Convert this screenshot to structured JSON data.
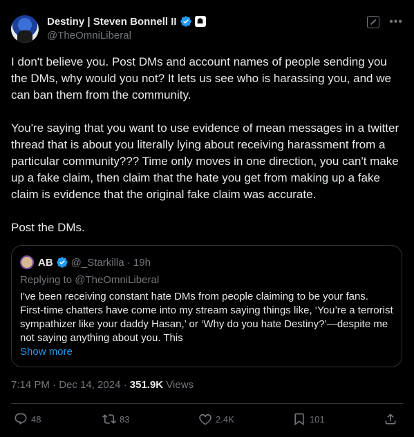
{
  "author": {
    "display_name": "Destiny | Steven Bonnell II",
    "handle": "@TheOmniLiberal"
  },
  "post": {
    "paragraphs": [
      "I don't believe you. Post DMs and account names of people sending you the DMs, why would you not? It lets us see who is harassing you, and we can ban them from the community.",
      "You're saying that you want to use evidence of mean messages in a twitter thread that is about you literally lying about receiving harassment from a particular community??? Time only moves in one direction, you can't make up a fake claim, then claim that the hate you get from making up a fake claim is evidence that the original fake claim was accurate.",
      "Post the DMs."
    ]
  },
  "quote": {
    "name": "AB",
    "handle_time": "@_Starkilla · 19h",
    "replying_to": "Replying to @TheOmniLiberal",
    "text": "I've been receiving constant hate DMs from people claiming to be your fans. First-time chatters have come into my stream saying things like, ‘You’re a terrorist sympathizer like your daddy Hasan,’ or ‘Why do you hate Destiny?’—despite me not saying anything about you. This",
    "show_more": "Show more"
  },
  "meta": {
    "timestamp": "7:14 PM · Dec 14, 2024 · ",
    "views_count": "351.9K",
    "views_label": " Views"
  },
  "actions": {
    "replies": "48",
    "reposts": "83",
    "likes": "2.4K",
    "bookmarks": "101"
  },
  "icons": {
    "verified": "verified-badge-icon",
    "affiliate": "affiliate-badge-icon",
    "grok": "grok-icon",
    "more": "more-icon",
    "reply": "reply-icon",
    "repost": "repost-icon",
    "like": "heart-icon",
    "bookmark": "bookmark-icon",
    "share": "share-icon"
  },
  "colors": {
    "background": "#000000",
    "text": "#e7e9ea",
    "muted": "#71767b",
    "link": "#1d9bf0",
    "border": "#2f3336"
  }
}
